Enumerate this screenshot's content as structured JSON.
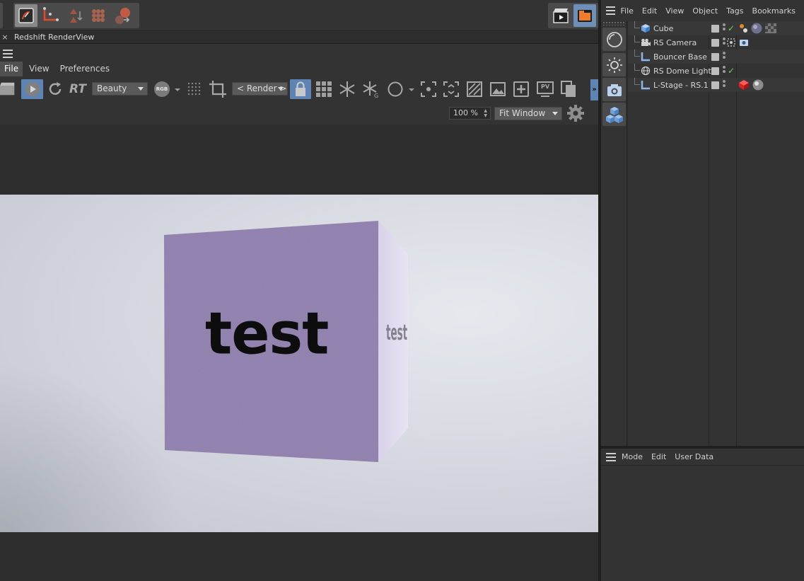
{
  "renderview": {
    "close_glyph": "×",
    "title": "Redshift RenderView",
    "menu": [
      "File",
      "View",
      "Preferences"
    ],
    "aov_dropdown": "Beauty",
    "rgb_label": "RGB",
    "rt_label": "RT",
    "render_dropdown": "< Render >",
    "zoom_value": "100 %",
    "fit_dropdown": "Fit Window",
    "pv_label": "PV",
    "collapse_glyph": "»"
  },
  "render": {
    "front_text": "test",
    "side_text": "test"
  },
  "object_manager": {
    "menu": [
      "File",
      "Edit",
      "View",
      "Object",
      "Tags",
      "Bookmarks"
    ],
    "objects": [
      {
        "name": "Cube"
      },
      {
        "name": "RS Camera"
      },
      {
        "name": "Bouncer Base"
      },
      {
        "name": "RS Dome Light"
      },
      {
        "name": "L-Stage - RS.1"
      }
    ]
  },
  "attributes": {
    "menu": [
      "Mode",
      "Edit",
      "User Data"
    ]
  },
  "colors": {
    "accent_blue": "#5e84b3",
    "cube_face": "#8f7fae",
    "cube_side": "#cfc6e3",
    "check_green": "#6fd05a"
  }
}
